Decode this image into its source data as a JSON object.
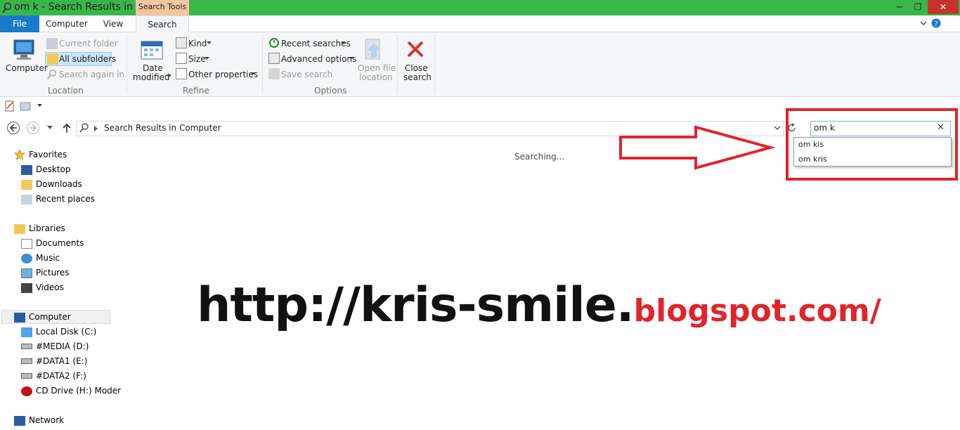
{
  "window": {
    "title": "om k - Search Results in ...",
    "contextual_tab": "Search Tools",
    "controls": {
      "minimize": "─",
      "maximize": "❐",
      "close": "✕"
    }
  },
  "ribbon_tabs": [
    "File",
    "Computer",
    "View",
    "Search"
  ],
  "ribbon": {
    "location": {
      "label": "Location",
      "computer": "Computer",
      "current_folder": "Current folder",
      "all_subfolders": "All subfolders",
      "search_again_in": "Search again in"
    },
    "refine": {
      "label": "Refine",
      "date_modified_line1": "Date",
      "date_modified_line2": "modified",
      "kind": "Kind",
      "size": "Size",
      "other_properties": "Other properties"
    },
    "options": {
      "label": "Options",
      "recent_searches": "Recent searches",
      "advanced_options": "Advanced options",
      "save_search": "Save search",
      "open_file_location_line1": "Open file",
      "open_file_location_line2": "location"
    },
    "close": {
      "line1": "Close",
      "line2": "search"
    }
  },
  "address_bar": {
    "path": "Search Results in Computer"
  },
  "search": {
    "value": "om k",
    "suggestions": [
      "om kis",
      "om kris"
    ]
  },
  "navigation": {
    "favorites": {
      "label": "Favorites",
      "items": [
        "Desktop",
        "Downloads",
        "Recent places"
      ]
    },
    "libraries": {
      "label": "Libraries",
      "items": [
        "Documents",
        "Music",
        "Pictures",
        "Videos"
      ]
    },
    "computer": {
      "label": "Computer",
      "items": [
        "Local Disk (C:)",
        "#MEDIA (D:)",
        "#DATA1 (E:)",
        "#DATA2 (F:)",
        "CD Drive (H:) Moder"
      ]
    },
    "network": {
      "label": "Network"
    }
  },
  "content": {
    "status": "Searching..."
  },
  "watermark": {
    "part1": "http://kris-smile.",
    "part2": "blogspot.com/"
  },
  "colors": {
    "titlebar": "#38b64a",
    "file_tab": "#1979ca",
    "contextual": "#f3c6a0",
    "annotation_red": "#e0242b"
  }
}
